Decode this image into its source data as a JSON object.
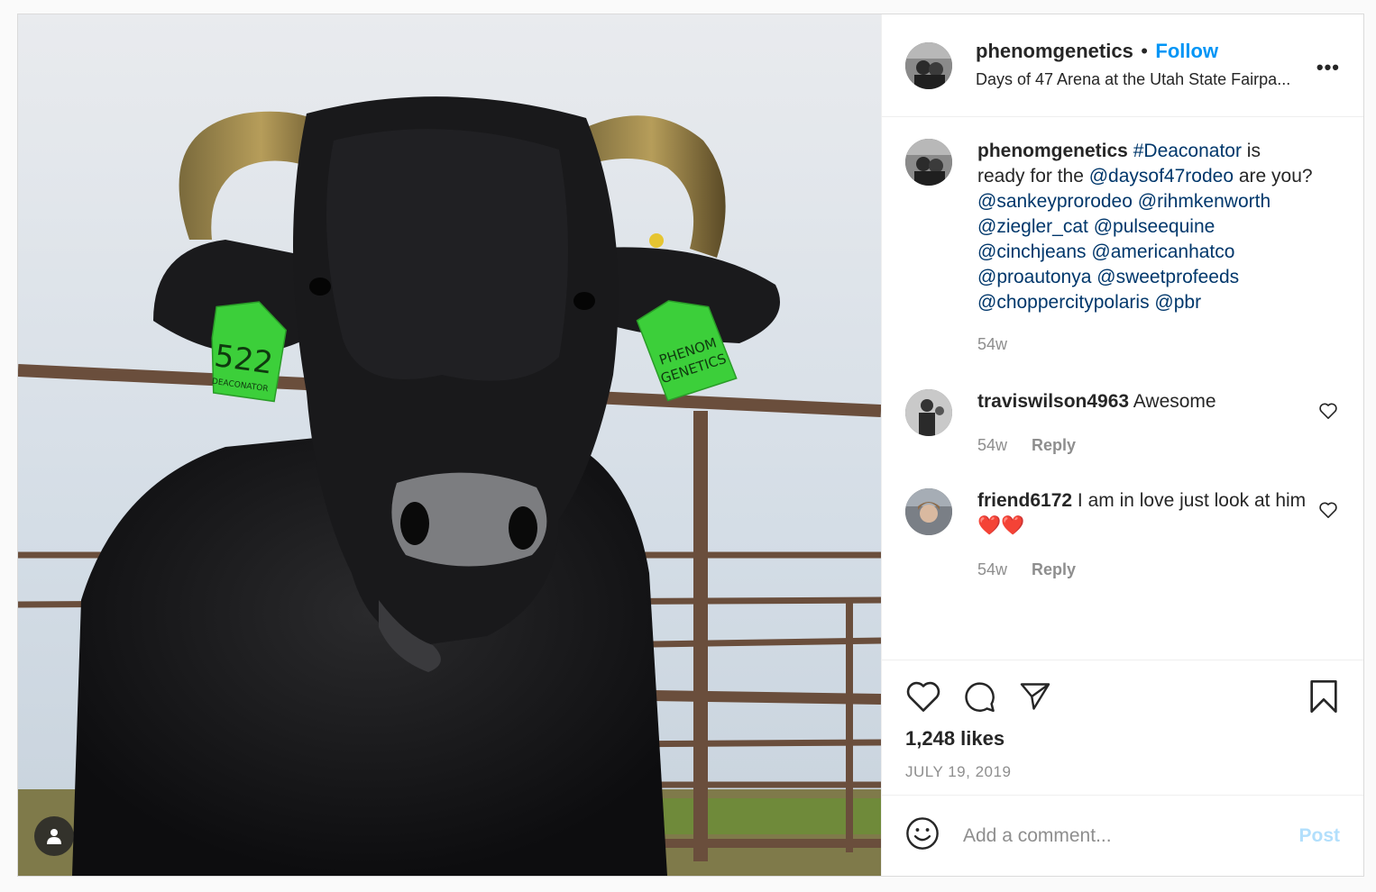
{
  "header": {
    "username": "phenomgenetics",
    "separator": "•",
    "follow_label": "Follow",
    "location": "Days of 47 Arena at the Utah State Fairpa...",
    "more_label": "•••"
  },
  "photo": {
    "ear_tag_left_number": "522",
    "ear_tag_left_name": "DEACONATOR",
    "ear_tag_right_line1": "PHENOM",
    "ear_tag_right_line2": "GENETICS"
  },
  "caption": {
    "username": "phenomgenetics",
    "t1": "#Deaconator",
    "t2": " is ready for the ",
    "t3": "@daysof47rodeo",
    "t4": " are you? ",
    "mentions": [
      "@sankeyprorodeo",
      "@rihmkenworth",
      "@ziegler_cat",
      "@pulseequine",
      "@cinchjeans",
      "@americanhatco",
      "@proautonya",
      "@sweetprofeeds",
      "@choppercitypolaris",
      "@pbr"
    ],
    "time": "54w"
  },
  "comments": [
    {
      "username": "traviswilson4963",
      "text": "Awesome",
      "time": "54w",
      "reply_label": "Reply"
    },
    {
      "username": "friend6172",
      "text": "I am in love just look at him❤️❤️",
      "time": "54w",
      "reply_label": "Reply"
    }
  ],
  "actions": {
    "likes": "1,248 likes",
    "date": "JULY 19, 2019"
  },
  "add_comment": {
    "placeholder": "Add a comment...",
    "post_label": "Post"
  },
  "colors": {
    "follow": "#0095f6",
    "link": "#00376b",
    "muted": "#8e8e8e",
    "tag_green": "#3ccf3a"
  }
}
